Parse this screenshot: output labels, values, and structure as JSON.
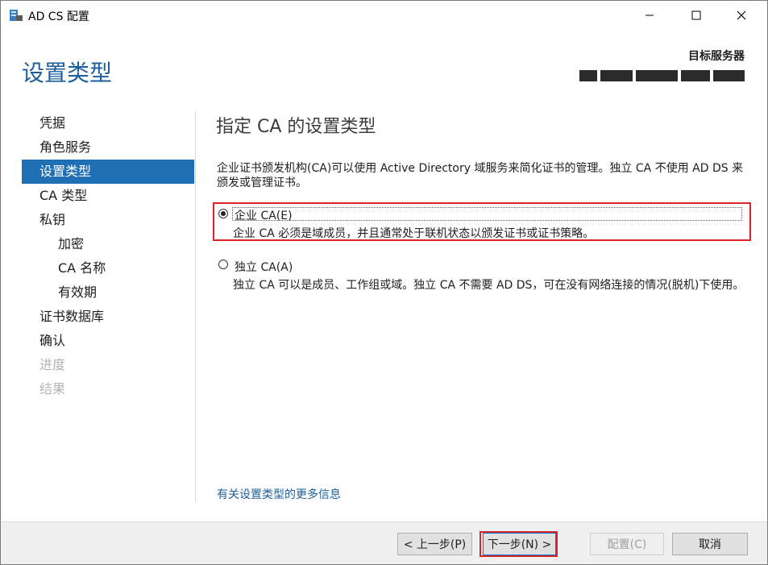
{
  "window": {
    "title": "AD CS 配置",
    "minimize_glyph": "—",
    "maximize_glyph": "☐",
    "close_glyph": "✕"
  },
  "header": {
    "page_title": "设置类型",
    "target_label": "目标服务器"
  },
  "nav": {
    "items": [
      {
        "label": "凭据",
        "state": "normal",
        "level": 0
      },
      {
        "label": "角色服务",
        "state": "normal",
        "level": 0
      },
      {
        "label": "设置类型",
        "state": "active",
        "level": 0
      },
      {
        "label": "CA 类型",
        "state": "normal",
        "level": 0
      },
      {
        "label": "私钥",
        "state": "normal",
        "level": 0
      },
      {
        "label": "加密",
        "state": "normal",
        "level": 1
      },
      {
        "label": "CA 名称",
        "state": "normal",
        "level": 1
      },
      {
        "label": "有效期",
        "state": "normal",
        "level": 1
      },
      {
        "label": "证书数据库",
        "state": "normal",
        "level": 0
      },
      {
        "label": "确认",
        "state": "normal",
        "level": 0
      },
      {
        "label": "进度",
        "state": "disabled",
        "level": 0
      },
      {
        "label": "结果",
        "state": "disabled",
        "level": 0
      }
    ]
  },
  "content": {
    "title": "指定 CA 的设置类型",
    "description": "企业证书颁发机构(CA)可以使用 Active Directory 域服务来简化证书的管理。独立 CA 不使用 AD DS 来颁发或管理证书。",
    "options": {
      "enterprise": {
        "label": "企业 CA(E)",
        "description": "企业 CA 必须是域成员，并且通常处于联机状态以颁发证书或证书策略。",
        "selected": true
      },
      "standalone": {
        "label": "独立 CA(A)",
        "description": "独立 CA 可以是成员、工作组或域。独立 CA 不需要 AD DS，可在没有网络连接的情况(脱机)下使用。",
        "selected": false
      }
    },
    "more_info_link": "有关设置类型的更多信息"
  },
  "footer": {
    "back_label": "< 上一步(P)",
    "next_label": "下一步(N) >",
    "configure_label": "配置(C)",
    "cancel_label": "取消"
  },
  "colors": {
    "accent": "#1f6fb5",
    "title_blue": "#1c5e9c",
    "highlight_red": "#d9232b"
  }
}
